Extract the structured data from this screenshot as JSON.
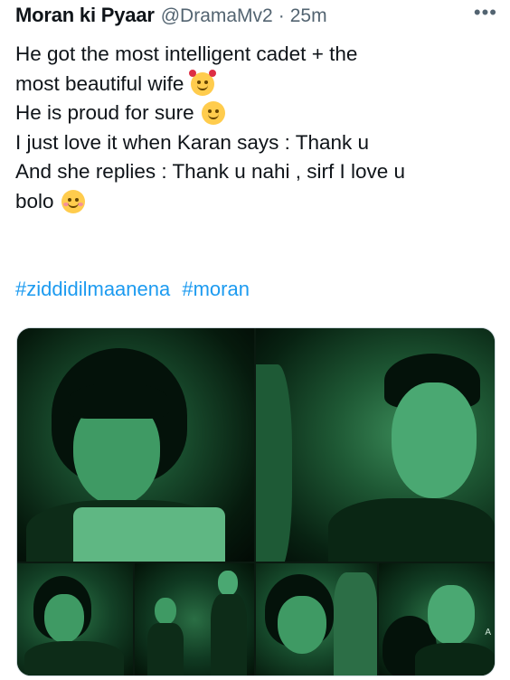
{
  "tweet": {
    "display_name": "Moran ki Pyaar",
    "handle": "@DramaMv2",
    "separator": "·",
    "time": "25m",
    "more_label": "•••",
    "lines": [
      {
        "text": "He got the most intelligent cadet + the",
        "emoji": null
      },
      {
        "text": "most beautiful wife",
        "emoji": "smiling-face-with-hearts-icon"
      },
      {
        "text": "He is proud for sure",
        "emoji": "smiling-face-icon"
      },
      {
        "text": "I just love it when Karan says : Thank u",
        "emoji": null
      },
      {
        "text": "And she replies  : Thank u nahi , sirf I love u",
        "emoji": null
      },
      {
        "text": "bolo",
        "emoji": "smiling-face-with-blush-icon"
      }
    ],
    "hashtags": [
      "#ziddidilmaanena",
      "#moran"
    ],
    "colors": {
      "link": "#1d9bf0",
      "secondary": "#536471",
      "text": "#0f1419"
    }
  },
  "media": {
    "images": [
      "photo-woman-closeup",
      "photo-man-closeup",
      "photo-woman-small",
      "photo-couple-holding-hands",
      "photo-woman-smiling",
      "photo-couple-closeup"
    ],
    "edge_text": "A"
  }
}
